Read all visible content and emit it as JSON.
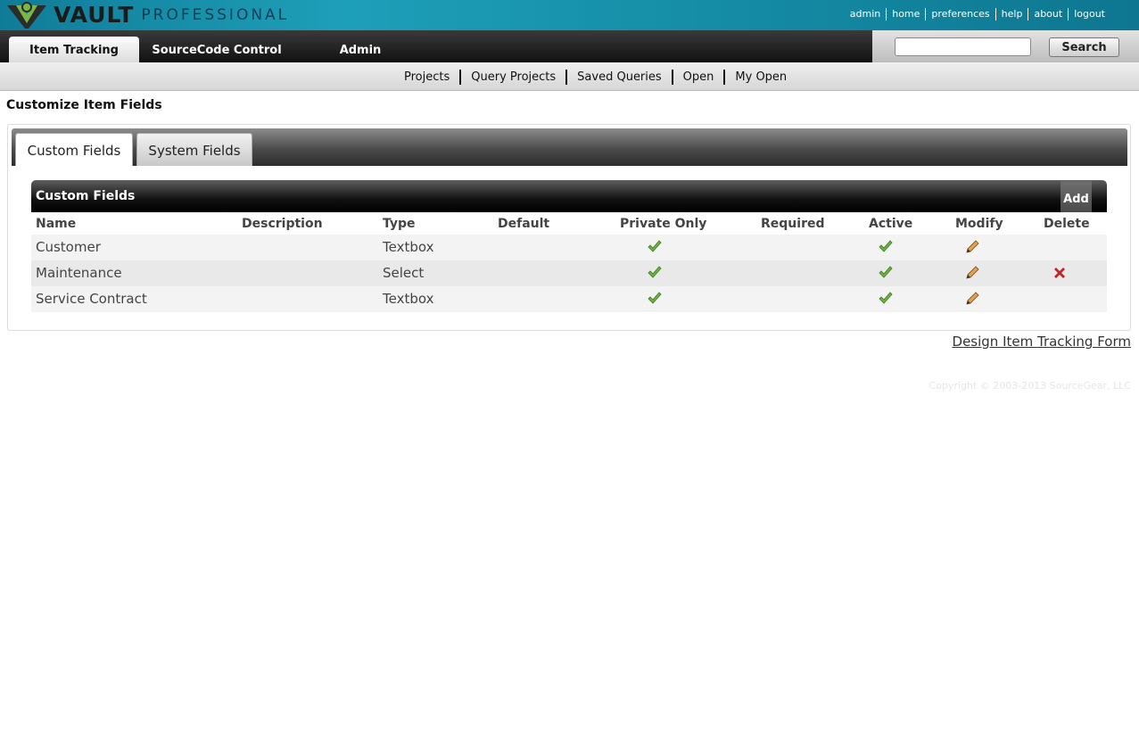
{
  "header": {
    "logo_word": "VAULT",
    "logo_sub": "PROFESSIONAL",
    "links": [
      "admin",
      "home",
      "preferences",
      "help",
      "about",
      "logout"
    ]
  },
  "nav": {
    "tabs": [
      "Item Tracking",
      "SourceCode Control",
      "Admin"
    ],
    "active_tab": "Item Tracking",
    "search_value": "",
    "search_button": "Search"
  },
  "subnav": {
    "items": [
      "Projects",
      "Query Projects",
      "Saved Queries",
      "Open",
      "My Open"
    ]
  },
  "page": {
    "title": "Customize Item Fields"
  },
  "content_tabs": {
    "items": [
      "Custom Fields",
      "System Fields"
    ],
    "active": "Custom Fields"
  },
  "grid": {
    "title": "Custom Fields",
    "add_label": "Add",
    "columns": [
      "Name",
      "Description",
      "Type",
      "Default",
      "Private Only",
      "Required",
      "Active",
      "Modify",
      "Delete"
    ],
    "rows": [
      {
        "name": "Customer",
        "description": "",
        "type": "Textbox",
        "default": "",
        "private_only": true,
        "required": false,
        "active": true,
        "modify": true,
        "delete": false
      },
      {
        "name": "Maintenance",
        "description": "",
        "type": "Select",
        "default": "",
        "private_only": true,
        "required": false,
        "active": true,
        "modify": true,
        "delete": true
      },
      {
        "name": "Service Contract",
        "description": "",
        "type": "Textbox",
        "default": "",
        "private_only": true,
        "required": false,
        "active": true,
        "modify": true,
        "delete": false
      }
    ]
  },
  "footer": {
    "design_link": "Design Item Tracking Form",
    "copyright": "Copyright © 2003-2013 SourceGear, LLC"
  },
  "colors": {
    "header_teal": "#168ea8",
    "check_green": "#6db33f",
    "delete_red": "#c0272d",
    "pencil": "#e0a050"
  }
}
